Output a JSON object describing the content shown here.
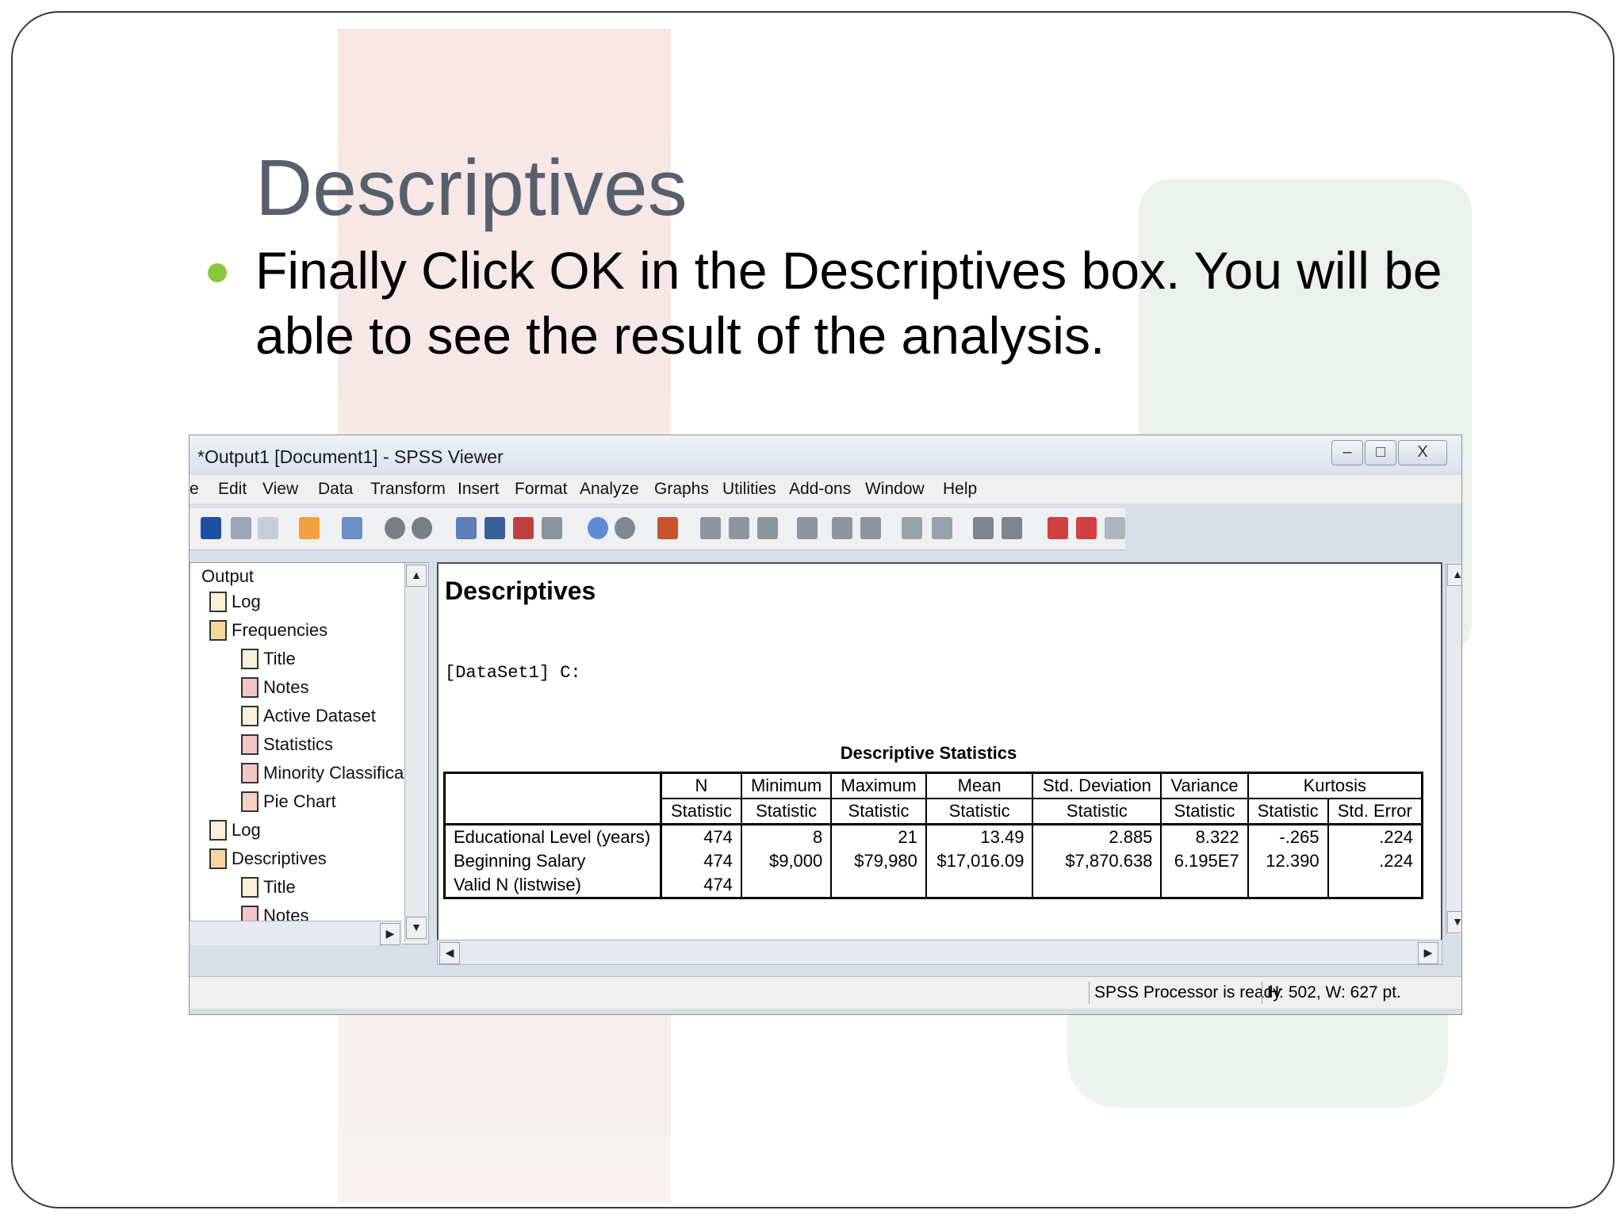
{
  "slide": {
    "title": "Descriptives",
    "bullet": "Finally Click OK in the Descriptives box. You will be able to see the result of the analysis."
  },
  "window": {
    "title": "*Output1 [Document1] - SPSS Viewer",
    "controls": {
      "minimize": "–",
      "maximize": "□",
      "close": "X"
    },
    "menu": [
      "e",
      "Edit",
      "View",
      "Data",
      "Transform",
      "Insert",
      "Format",
      "Analyze",
      "Graphs",
      "Utilities",
      "Add-ons",
      "Window",
      "Help"
    ]
  },
  "navigator": {
    "items": [
      {
        "label": "Output",
        "icon": "folder-icon"
      },
      {
        "label": "Log",
        "icon": "log-icon"
      },
      {
        "label": "Frequencies",
        "icon": "procedure-icon"
      },
      {
        "label": "Title",
        "icon": "title-icon"
      },
      {
        "label": "Notes",
        "icon": "notes-icon"
      },
      {
        "label": "Active Dataset",
        "icon": "dataset-icon"
      },
      {
        "label": "Statistics",
        "icon": "table-icon"
      },
      {
        "label": "Minority Classificati",
        "icon": "table-icon"
      },
      {
        "label": "Pie Chart",
        "icon": "chart-icon"
      },
      {
        "label": "Log",
        "icon": "log-icon"
      },
      {
        "label": "Descriptives",
        "icon": "procedure-icon"
      },
      {
        "label": "Title",
        "icon": "title-icon"
      },
      {
        "label": "Notes",
        "icon": "notes-icon"
      }
    ]
  },
  "output": {
    "heading": "Descriptives",
    "dataset": "[DataSet1] C:",
    "table_title": "Descriptive Statistics",
    "columns": [
      "N",
      "Minimum",
      "Maximum",
      "Mean",
      "Std. Deviation",
      "Variance",
      "Kurtosis"
    ],
    "subcolumns": [
      "Statistic",
      "Statistic",
      "Statistic",
      "Statistic",
      "Statistic",
      "Statistic",
      "Statistic",
      "Std. Error"
    ],
    "rows": [
      {
        "label": "Educational Level (years)",
        "values": [
          "474",
          "8",
          "21",
          "13.49",
          "2.885",
          "8.322",
          "-.265",
          ".224"
        ]
      },
      {
        "label": "Beginning Salary",
        "values": [
          "474",
          "$9,000",
          "$79,980",
          "$17,016.09",
          "$7,870.638",
          "6.195E7",
          "12.390",
          ".224"
        ]
      },
      {
        "label": "Valid N (listwise)",
        "values": [
          "474",
          "",
          "",
          "",
          "",
          "",
          "",
          ""
        ]
      }
    ]
  },
  "status": {
    "processor": "SPSS  Processor is ready",
    "dimensions": "H: 502, W: 627 pt."
  }
}
